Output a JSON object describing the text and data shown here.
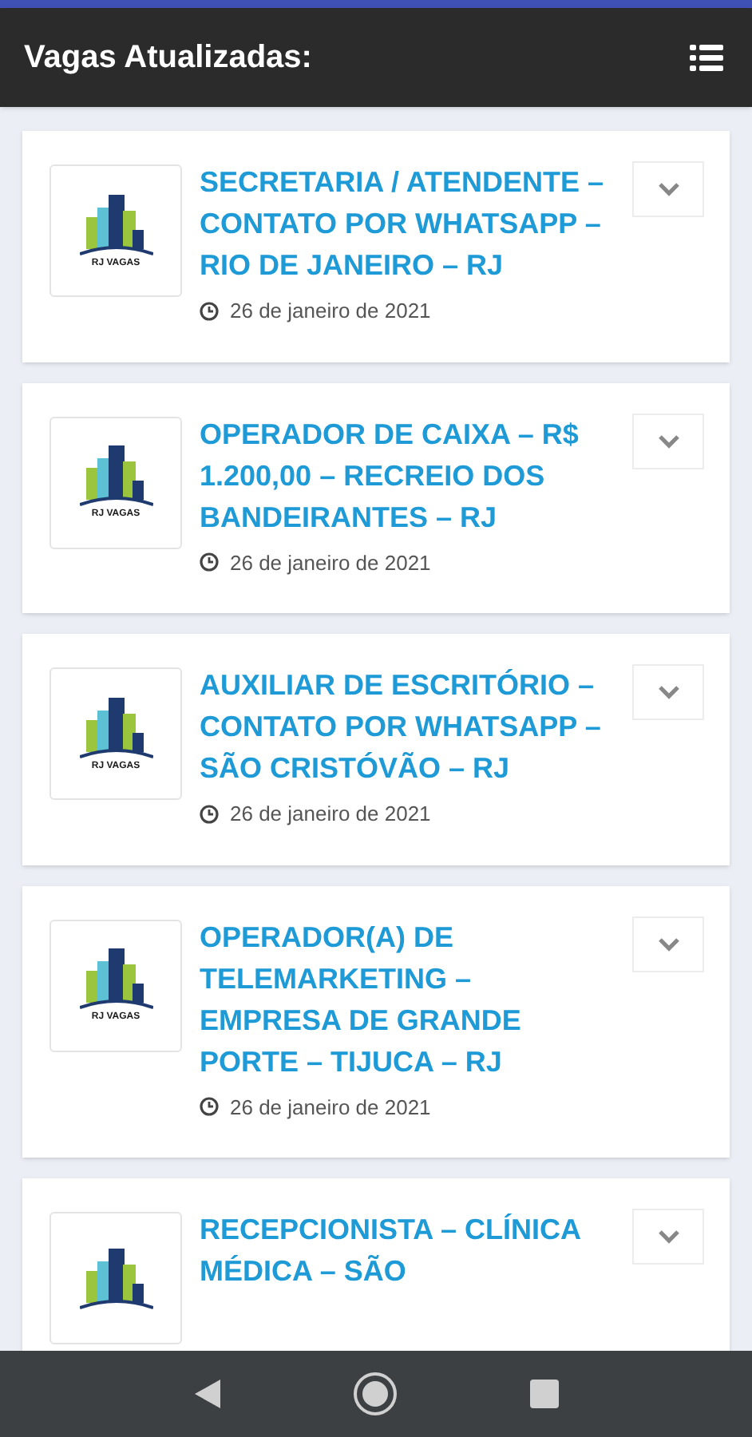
{
  "header": {
    "title": "Vagas Atualizadas:"
  },
  "jobs": [
    {
      "logo_text": "RJ VAGAS",
      "title": "SECRETARIA / ATENDENTE – CONTATO POR WHATSAPP – RIO DE JANEIRO – RJ",
      "date": "26 de janeiro de 2021"
    },
    {
      "logo_text": "RJ VAGAS",
      "title": "OPERADOR DE CAIXA – R$ 1.200,00 – RECREIO DOS BANDEIRANTES – RJ",
      "date": "26 de janeiro de 2021"
    },
    {
      "logo_text": "RJ VAGAS",
      "title": "AUXILIAR DE ESCRITÓRIO – CONTATO POR WHATSAPP – SÃO CRISTÓVÃO – RJ",
      "date": "26 de janeiro de 2021"
    },
    {
      "logo_text": "RJ VAGAS",
      "title": "OPERADOR(A) DE TELEMARKETING – EMPRESA DE GRANDE PORTE – TIJUCA – RJ",
      "date": "26 de janeiro de 2021"
    },
    {
      "title": "RECEPCIONISTA – CLÍNICA MÉDICA – SÃO"
    }
  ]
}
